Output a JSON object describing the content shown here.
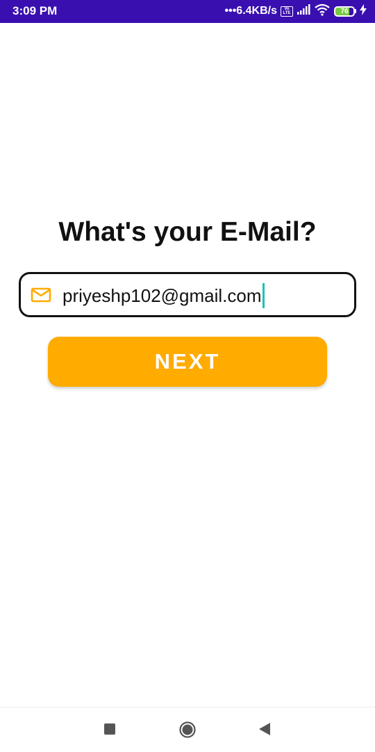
{
  "status_bar": {
    "time": "3:09 PM",
    "net_speed": "•••6.4KB/s",
    "volte_label": "Vo LTE",
    "signal_icon": "signal-bars-icon",
    "wifi_icon": "wifi-icon",
    "battery_level": "76",
    "charging_icon": "bolt-icon",
    "background_color": "#3a0fb0"
  },
  "main": {
    "heading": "What's your E-Mail?",
    "email_field": {
      "icon": "mail-icon",
      "value": "priyeshp102@gmail.com",
      "icon_color": "#ffab00",
      "caret_color": "#1bc2b8"
    },
    "next_button": {
      "label": "NEXT",
      "color": "#ffab00"
    }
  },
  "nav_bar": {
    "recents_icon": "square-icon",
    "home_icon": "circle-home-icon",
    "back_icon": "back-triangle-icon"
  }
}
